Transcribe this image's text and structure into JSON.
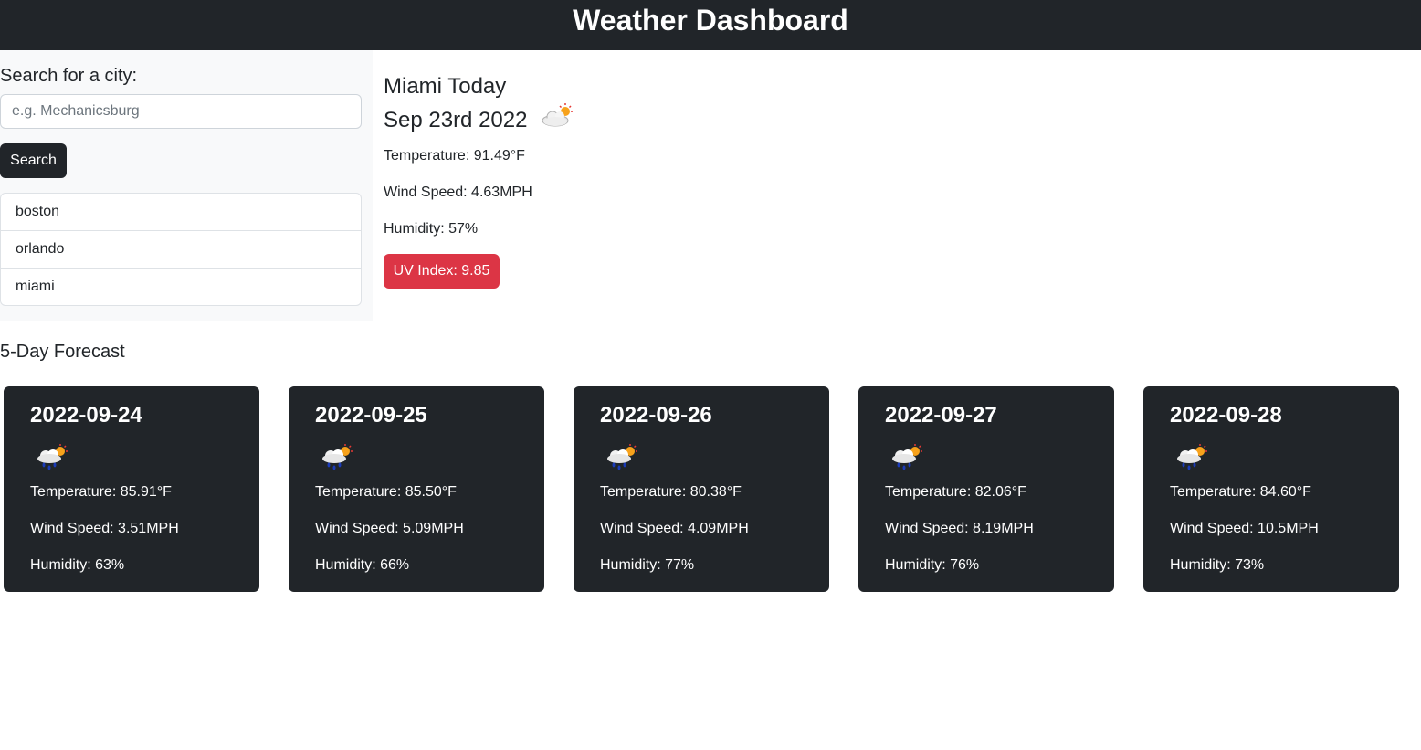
{
  "header": {
    "title": "Weather Dashboard"
  },
  "sidebar": {
    "search_label": "Search for a city:",
    "search_placeholder": "e.g. Mechanicsburg",
    "search_value": "",
    "search_button": "Search",
    "history": [
      "boston",
      "orlando",
      "miami"
    ]
  },
  "current": {
    "city_title": "Miami Today",
    "date": "Sep 23rd 2022",
    "icon": "partly-cloudy-sun-icon",
    "temperature": "Temperature: 91.49°F",
    "wind": "Wind Speed: 4.63MPH",
    "humidity": "Humidity: 57%",
    "uv": "UV Index: 9.85",
    "uv_color": "#dc3545"
  },
  "forecast": {
    "title": "5-Day Forecast",
    "days": [
      {
        "date": "2022-09-24",
        "icon": "rain-cloud-sun-icon",
        "temperature": "Temperature: 85.91°F",
        "wind": "Wind Speed: 3.51MPH",
        "humidity": "Humidity: 63%"
      },
      {
        "date": "2022-09-25",
        "icon": "rain-cloud-sun-icon",
        "temperature": "Temperature: 85.50°F",
        "wind": "Wind Speed: 5.09MPH",
        "humidity": "Humidity: 66%"
      },
      {
        "date": "2022-09-26",
        "icon": "rain-cloud-sun-icon",
        "temperature": "Temperature: 80.38°F",
        "wind": "Wind Speed: 4.09MPH",
        "humidity": "Humidity: 77%"
      },
      {
        "date": "2022-09-27",
        "icon": "rain-cloud-sun-icon",
        "temperature": "Temperature: 82.06°F",
        "wind": "Wind Speed: 8.19MPH",
        "humidity": "Humidity: 76%"
      },
      {
        "date": "2022-09-28",
        "icon": "rain-cloud-sun-icon",
        "temperature": "Temperature: 84.60°F",
        "wind": "Wind Speed: 10.5MPH",
        "humidity": "Humidity: 73%"
      }
    ]
  },
  "colors": {
    "dark": "#212529",
    "light_bg": "#f8f9fa",
    "danger": "#dc3545"
  }
}
